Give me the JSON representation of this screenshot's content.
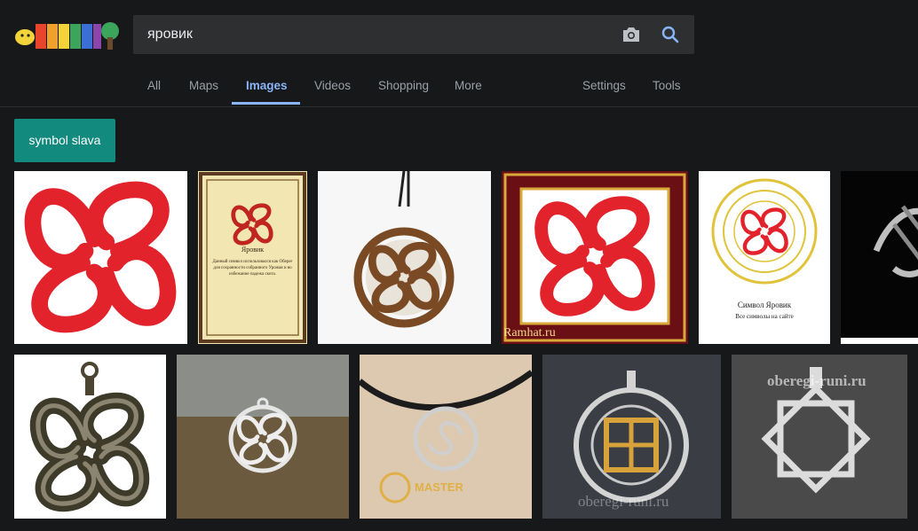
{
  "search": {
    "query": "яровик"
  },
  "nav": {
    "all": "All",
    "maps": "Maps",
    "images": "Images",
    "videos": "Videos",
    "shopping": "Shopping",
    "more": "More",
    "settings": "Settings",
    "tools": "Tools"
  },
  "chip": {
    "label": "symbol slava"
  },
  "thumbs": {
    "card_title": "Яровик",
    "card_text": "Данный символ использовался как Оберег для сохранности собранного Урожая и во избежание падежа скота.",
    "poster_title": "Символ Яровик",
    "poster_sub": "Все символы на сайте",
    "watermark_ramhat": "Ramhat.ru",
    "watermark_oberegi_top": "oberegi-runi.ru",
    "watermark_oberegi": "oberegi-runi.ru",
    "watermark_master": "MASTER"
  },
  "colors": {
    "accent": "#8ab4f8",
    "chip": "#128a7e",
    "background": "#17181a",
    "symbol_red": "#e3232c"
  }
}
